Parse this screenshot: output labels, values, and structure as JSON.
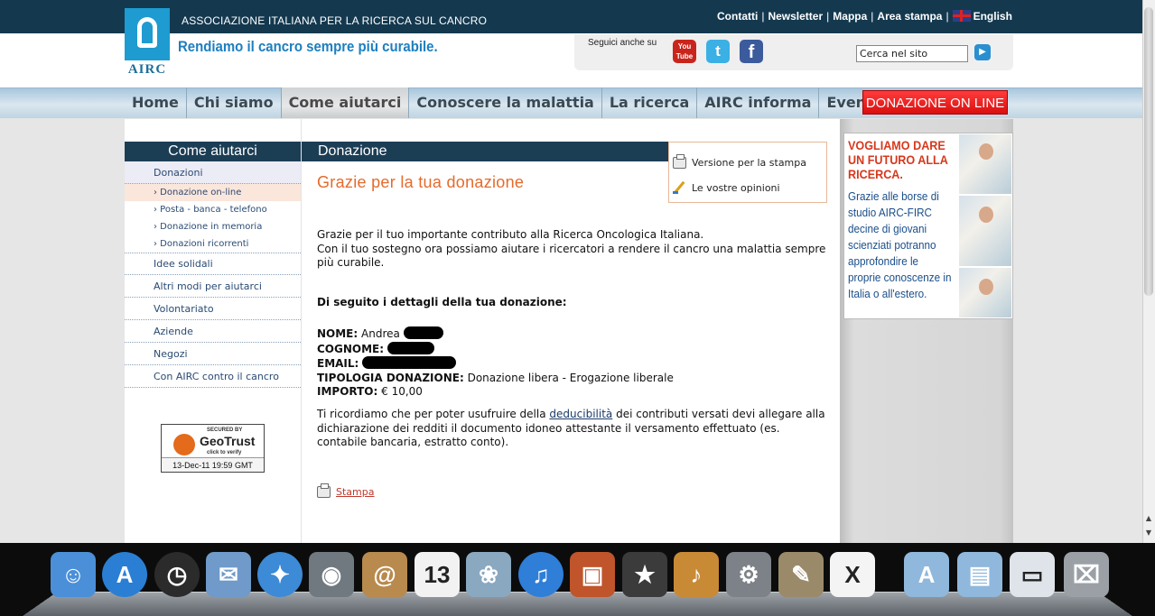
{
  "header": {
    "logo_text": "AIRC",
    "association": "ASSOCIAZIONE ITALIANA PER LA RICERCA SUL CANCRO",
    "tagline": "Rendiamo il cancro sempre più curabile.",
    "top_links": [
      "Contatti",
      "Newsletter",
      "Mappa",
      "Area stampa",
      "English"
    ],
    "separator": "|",
    "follow_label": "Seguici anche su",
    "social": {
      "youtube": "You\nTube",
      "twitter": "t",
      "facebook": "f"
    },
    "search_value": "Cerca nel sito"
  },
  "nav": {
    "tabs": [
      "Home",
      "Chi siamo",
      "Come aiutarci",
      "Conoscere la malattia",
      "La ricerca",
      "AIRC informa",
      "Eventi"
    ],
    "active_index": 2,
    "donate_label": "DONAZIONE ON LINE"
  },
  "sidebar": {
    "title": "Come aiutarci",
    "items": [
      {
        "label": "Donazioni",
        "level": "main",
        "selected": true
      },
      {
        "label": "› Donazione on-line",
        "level": "sub",
        "selected": true
      },
      {
        "label": "› Posta - banca - telefono",
        "level": "sub",
        "selected": false
      },
      {
        "label": "› Donazione in memoria",
        "level": "sub",
        "selected": false
      },
      {
        "label": "› Donazioni ricorrenti",
        "level": "sub",
        "selected": false
      },
      {
        "label": "Idee solidali",
        "level": "main",
        "selected": false
      },
      {
        "label": "Altri modi per aiutarci",
        "level": "main",
        "selected": false
      },
      {
        "label": "Volontariato",
        "level": "main",
        "selected": false
      },
      {
        "label": "Aziende",
        "level": "main",
        "selected": false
      },
      {
        "label": "Negozi",
        "level": "main",
        "selected": false
      },
      {
        "label": "Con AIRC contro il cancro",
        "level": "main",
        "selected": false
      }
    ],
    "geotrust": {
      "secured_by": "SECURED BY",
      "brand": "GeoTrust",
      "click": "click to verify",
      "date": "13-Dec-11 19:59 GMT"
    }
  },
  "main": {
    "section_title": "Donazione",
    "tools": {
      "print": "Versione per la stampa",
      "opinions": "Le vostre opinioni"
    },
    "heading": "Grazie per la tua donazione",
    "thanks_line1": "Grazie per il tuo importante contributo alla Ricerca Oncologica Italiana.",
    "thanks_line2": "Con il tuo sostegno ora possiamo aiutare i ricercatori a rendere il cancro una malattia sempre più curabile.",
    "details_heading": "Di seguito i dettagli della tua donazione:",
    "details": {
      "name_label": "NOME:",
      "name_value": "Andrea",
      "surname_label": "COGNOME:",
      "email_label": "EMAIL:",
      "type_label": "TIPOLOGIA DONAZIONE:",
      "type_value": "Donazione libera - Erogazione liberale",
      "amount_label": "IMPORTO:",
      "amount_value": "€ 10,00"
    },
    "deduct_before": "Ti ricordiamo che per poter usufruire della",
    "deduct_link": "deducibilità",
    "deduct_after": "dei contributi versati devi allegare alla dichiarazione dei redditi il documento idoneo attestante il versamento effettuato (es. contabile bancaria, estratto conto).",
    "print_link": "Stampa"
  },
  "ad": {
    "title": "VOGLIAMO DARE UN FUTURO ALLA RICERCA.",
    "text": "Grazie alle borse di studio AIRC-FIRC decine di giovani scienziati potranno approfondire le proprie conoscenze in Italia o all'estero."
  },
  "dock": {
    "apps": [
      {
        "name": "finder",
        "glyph": "☺",
        "color": "#4a8fd8"
      },
      {
        "name": "app-store",
        "glyph": "A",
        "color": "#2a7fd4"
      },
      {
        "name": "dashboard",
        "glyph": "◷",
        "color": "#2b2b2b"
      },
      {
        "name": "mail",
        "glyph": "✉",
        "color": "#6f9ac9"
      },
      {
        "name": "safari",
        "glyph": "✦",
        "color": "#3d8ad6"
      },
      {
        "name": "facetime",
        "glyph": "◉",
        "color": "#707880"
      },
      {
        "name": "address-book",
        "glyph": "@",
        "color": "#b88a4e"
      },
      {
        "name": "ical",
        "glyph": "13",
        "color": "#f2f2f2"
      },
      {
        "name": "iphoto",
        "glyph": "❀",
        "color": "#8aa8c0"
      },
      {
        "name": "itunes",
        "glyph": "♫",
        "color": "#2f7ed8"
      },
      {
        "name": "photo-booth",
        "glyph": "▣",
        "color": "#c0542a"
      },
      {
        "name": "imovie",
        "glyph": "★",
        "color": "#3b3b3b"
      },
      {
        "name": "garageband",
        "glyph": "♪",
        "color": "#c98a36"
      },
      {
        "name": "system-preferences",
        "glyph": "⚙",
        "color": "#7d8288"
      },
      {
        "name": "gimp",
        "glyph": "✎",
        "color": "#9a8a6a"
      },
      {
        "name": "x11",
        "glyph": "X",
        "color": "#f4f4f4"
      },
      {
        "name": "applications-folder",
        "glyph": "A",
        "color": "#8fb8dc"
      },
      {
        "name": "documents-folder",
        "glyph": "▤",
        "color": "#8fb8dc"
      },
      {
        "name": "downloads-stack",
        "glyph": "▭",
        "color": "#dfe4ea"
      },
      {
        "name": "trash",
        "glyph": "⌧",
        "color": "#9aa0a6"
      }
    ]
  }
}
